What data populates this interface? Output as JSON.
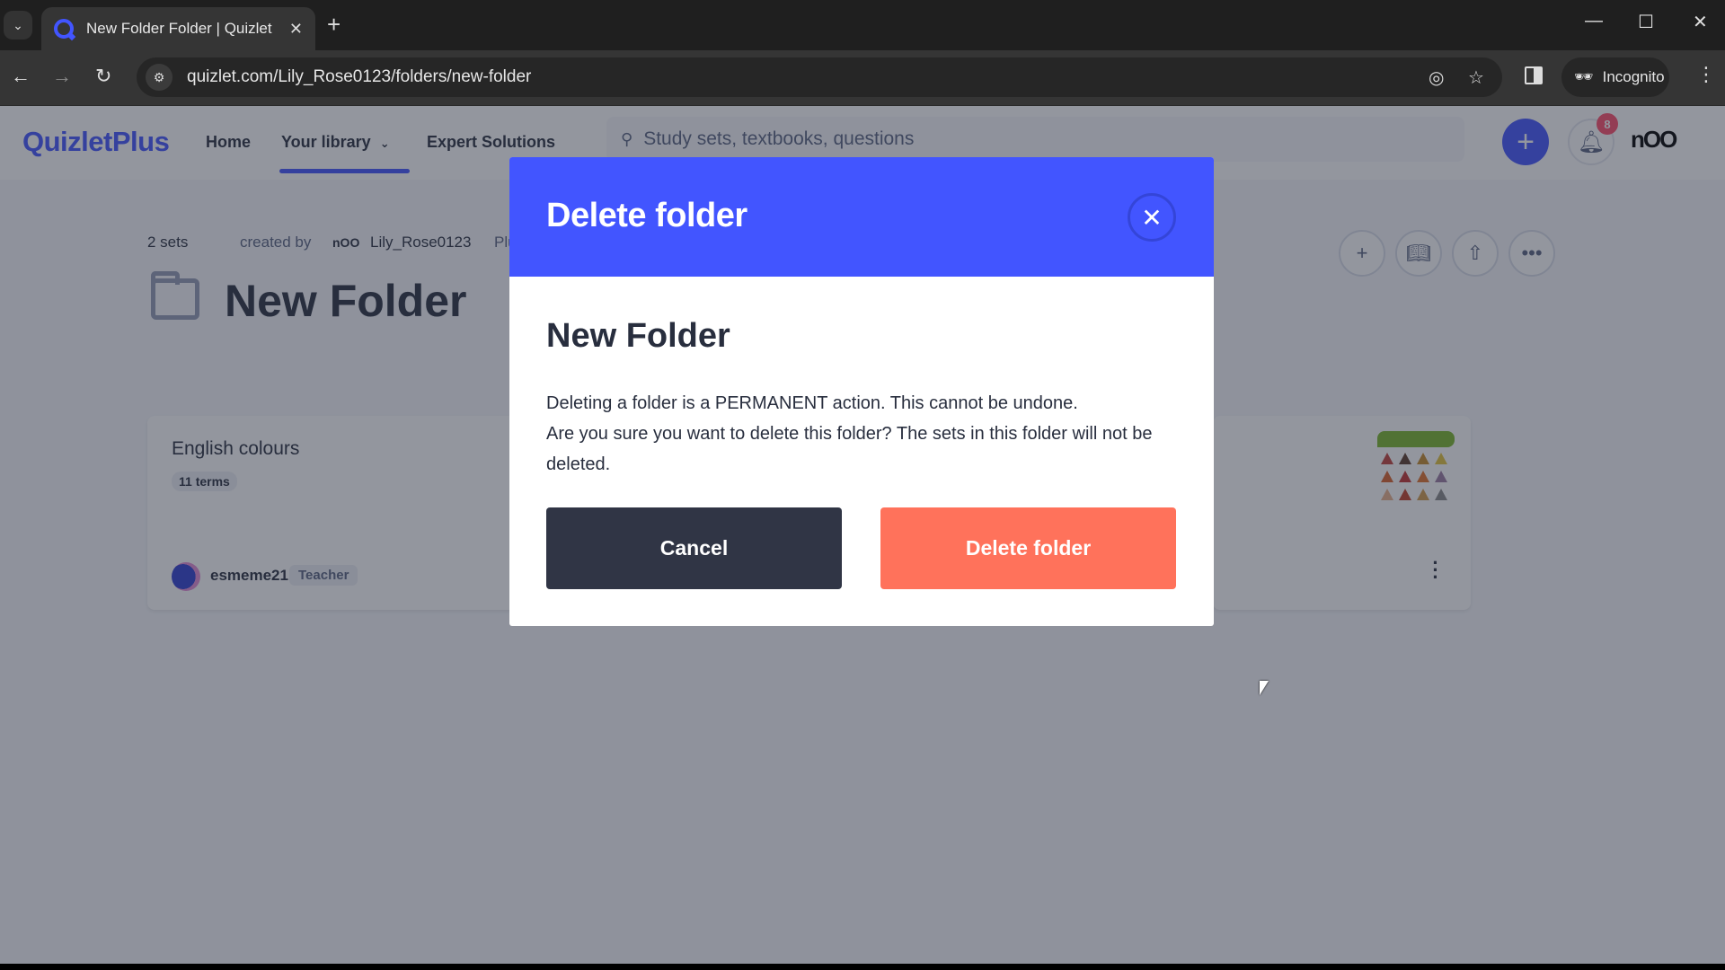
{
  "browser": {
    "tab_title": "New Folder Folder | Quizlet",
    "url": "quizlet.com/Lily_Rose0123/folders/new-folder",
    "incognito_label": "Incognito"
  },
  "nav": {
    "logo": "QuizletPlus",
    "links": [
      "Home",
      "Your library",
      "Expert Solutions"
    ],
    "search_placeholder": "Study sets, textbooks, questions",
    "notification_count": "8",
    "avatar_text": "nOO"
  },
  "folder": {
    "sets_count": "2 sets",
    "created_by_label": "created by",
    "creator": "Lily_Rose0123",
    "creator_badge": "Plus",
    "title": "New Folder"
  },
  "sets": [
    {
      "title": "English colours",
      "terms": "11 terms",
      "author": "esmeme21",
      "author_role": "Teacher"
    },
    {
      "thumbnail_label": "TRIANGLE"
    }
  ],
  "modal": {
    "title": "Delete folder",
    "folder_name": "New Folder",
    "line1": "Deleting a folder is a PERMANENT action. This cannot be undone.",
    "line2": "Are you sure you want to delete this folder? The sets in this folder will not be deleted.",
    "cancel_label": "Cancel",
    "delete_label": "Delete folder"
  },
  "colors": {
    "brand": "#4255ff",
    "danger": "#ff725b",
    "dark": "#303545"
  }
}
